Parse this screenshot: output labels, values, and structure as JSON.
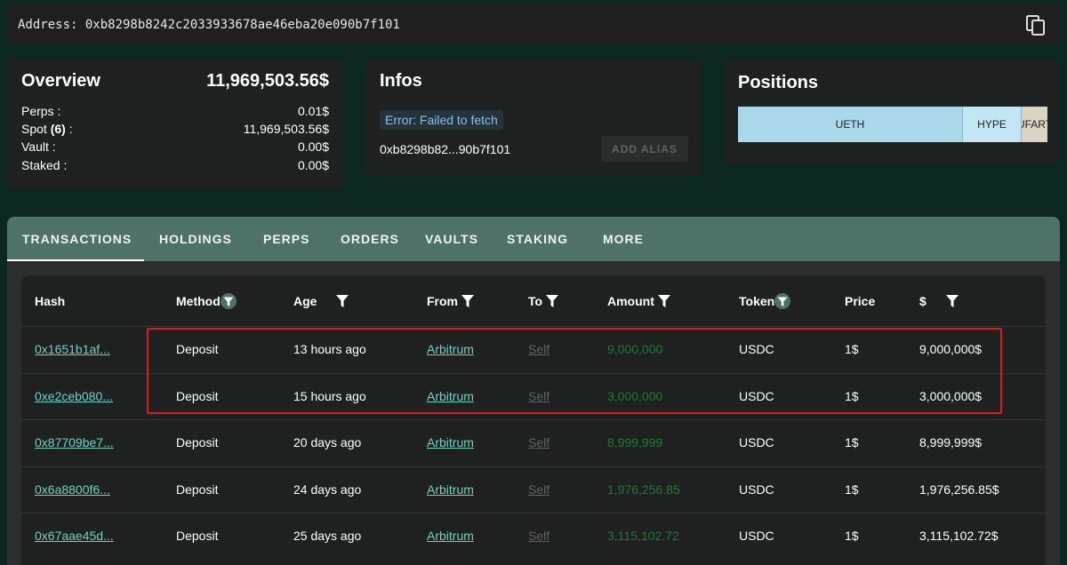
{
  "address_bar": {
    "label": "Address: 0xb8298b8242c2033933678ae46eba20e090b7f101"
  },
  "overview": {
    "title": "Overview",
    "total": "11,969,503.56$",
    "rows": [
      {
        "label": "Perps :",
        "value": "0.01$"
      },
      {
        "label_prefix": "Spot ",
        "label_bold": "(6)",
        "label_suffix": " :",
        "value": "11,969,503.56$"
      },
      {
        "label": "Vault :",
        "value": "0.00$"
      },
      {
        "label": "Staked :",
        "value": "0.00$"
      }
    ]
  },
  "infos": {
    "title": "Infos",
    "error": "Error: Failed to fetch",
    "short_address": "0xb8298b82...90b7f101",
    "alias_button": "ADD ALIAS"
  },
  "positions": {
    "title": "Positions",
    "segments": [
      {
        "label": "UETH",
        "share": 0.725,
        "color": "#a8d8ea"
      },
      {
        "label": "HYPE",
        "share": 0.19,
        "color": "#c2e6f3"
      },
      {
        "label": "UFART",
        "share": 0.085,
        "color": "#d9d4c4"
      }
    ]
  },
  "tabs": [
    "TRANSACTIONS",
    "HOLDINGS",
    "PERPS",
    "ORDERS",
    "VAULTS",
    "STAKING",
    "MORE"
  ],
  "active_tab": "TRANSACTIONS",
  "table": {
    "headers": {
      "hash": "Hash",
      "method": "Method",
      "age": "Age",
      "from": "From",
      "to": "To",
      "amount": "Amount",
      "token": "Token",
      "price": "Price",
      "usd": "$"
    },
    "rows": [
      {
        "hash": "0x1651b1af...",
        "method": "Deposit",
        "age": "13 hours ago",
        "from": "Arbitrum",
        "to": "Self",
        "amount": "9,000,000",
        "token": "USDC",
        "price": "1$",
        "usd": "9,000,000$"
      },
      {
        "hash": "0xe2ceb080...",
        "method": "Deposit",
        "age": "15 hours ago",
        "from": "Arbitrum",
        "to": "Self",
        "amount": "3,000,000",
        "token": "USDC",
        "price": "1$",
        "usd": "3,000,000$"
      },
      {
        "hash": "0x87709be7...",
        "method": "Deposit",
        "age": "20 days ago",
        "from": "Arbitrum",
        "to": "Self",
        "amount": "8,999,999",
        "token": "USDC",
        "price": "1$",
        "usd": "8,999,999$"
      },
      {
        "hash": "0x6a8800f6...",
        "method": "Deposit",
        "age": "24 days ago",
        "from": "Arbitrum",
        "to": "Self",
        "amount": "1,976,256.85",
        "token": "USDC",
        "price": "1$",
        "usd": "1,976,256.85$"
      },
      {
        "hash": "0x67aae45d...",
        "method": "Deposit",
        "age": "25 days ago",
        "from": "Arbitrum",
        "to": "Self",
        "amount": "3,115,102.72",
        "token": "USDC",
        "price": "1$",
        "usd": "3,115,102.72$"
      }
    ]
  },
  "colors": {
    "background": "#0c2621",
    "card": "#1f2120",
    "tab_bar": "#4e7269",
    "link": "#6fd3c3",
    "amount": "#1e7a34",
    "highlight": "#e1161e",
    "error_text": "#7ec3f0"
  }
}
